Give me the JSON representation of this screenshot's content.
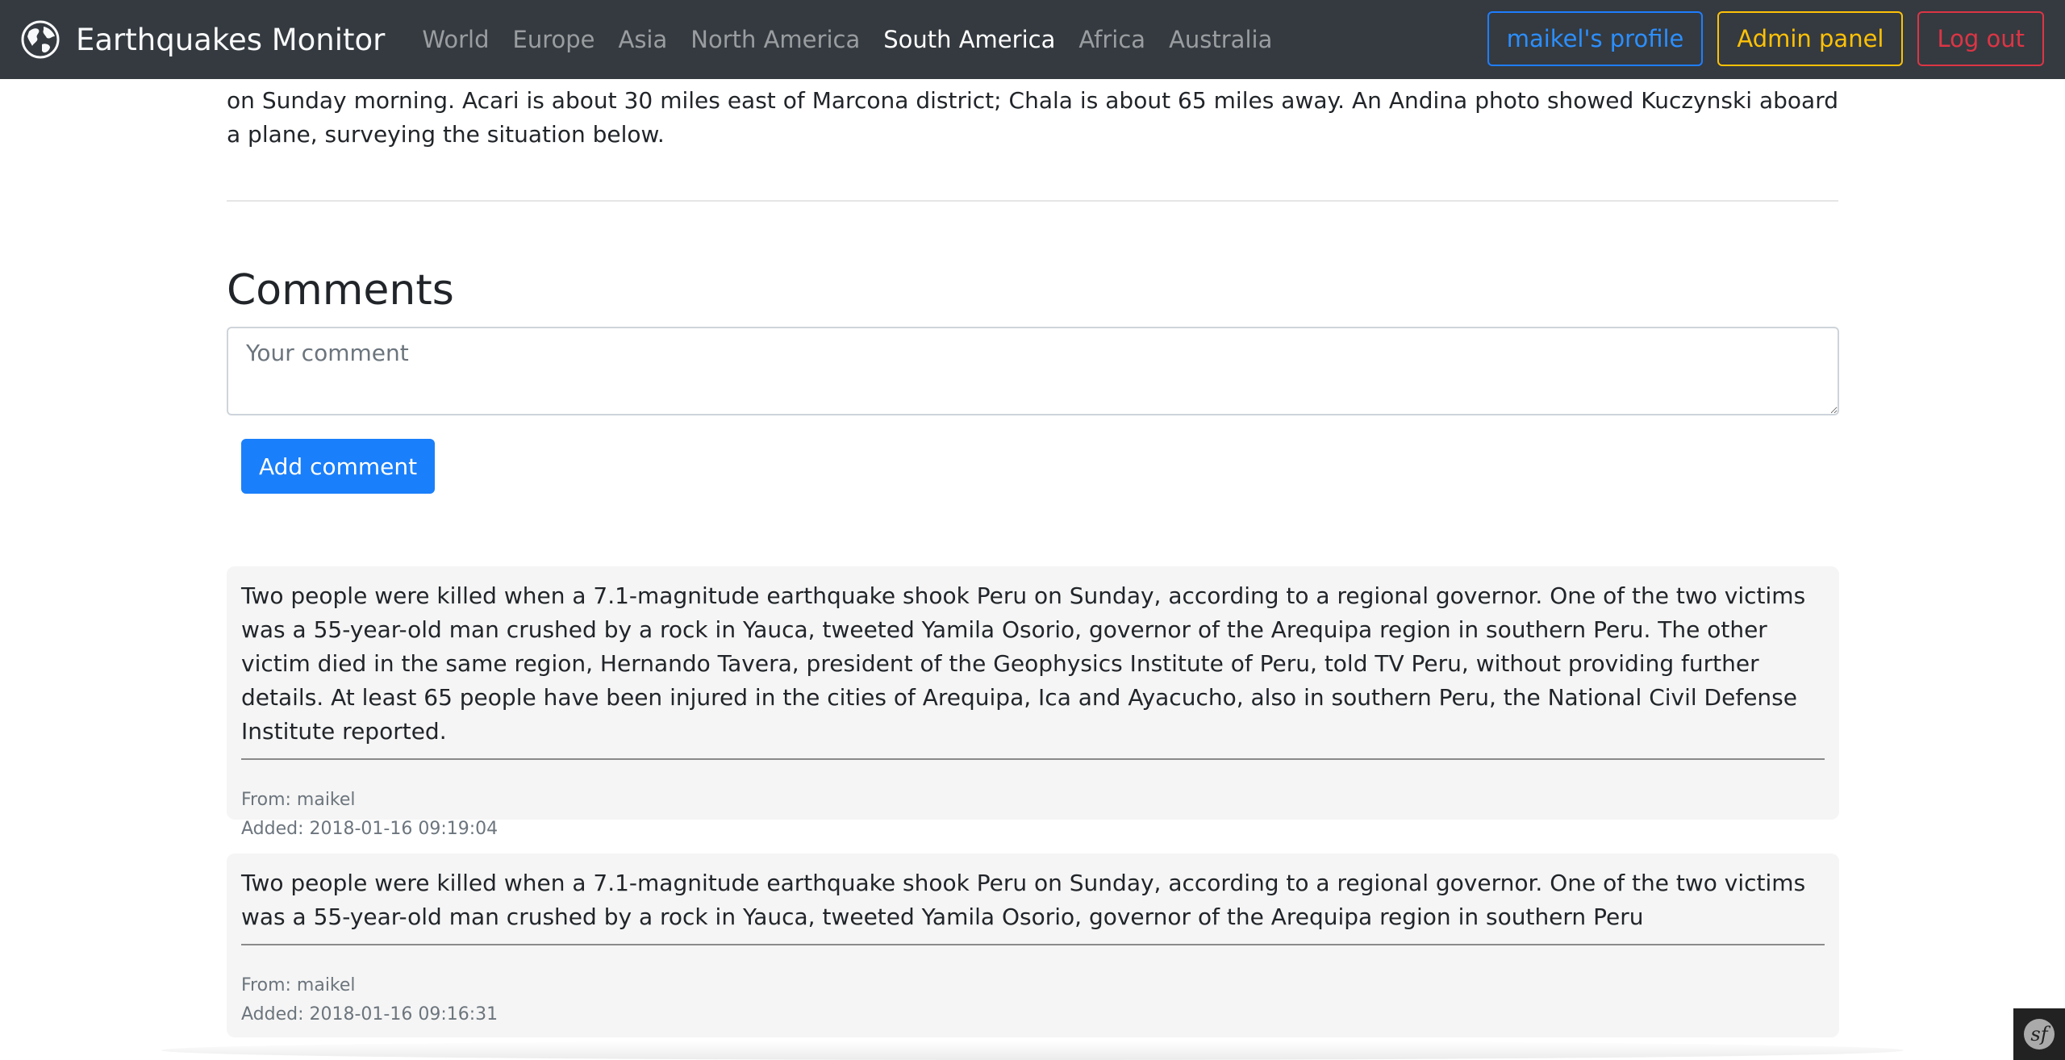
{
  "article": {
    "lines_text": "USGS said. Though it damaged roads in the region, ports and airports continue to operate normally, reported Andina, the state-run news agency. \"At this moment, we are heading from Marcona to Acari and Chala (Arequipa), zones affected by the earthquake overnight, to verify the magnitude of the damages and to send the corresponding humanitarian assistance,\" President Pedro Pablo Kuczynski tweeted in Spanish on Sunday morning. Acari is about 30 miles east of Marcona district; Chala is about 65 miles away. An Andina photo showed Kuczynski aboard a plane, surveying the situation below."
  },
  "navbar": {
    "brand": "Earthquakes Monitor",
    "links": [
      "World",
      "Europe",
      "Asia",
      "North America",
      "South America",
      "Africa",
      "Australia"
    ],
    "active_link": "South America",
    "profile_button": "maikel's profile",
    "admin_button": "Admin panel",
    "logout_button": "Log out"
  },
  "comments": {
    "title": "Comments",
    "input_placeholder": "Your comment",
    "add_button": "Add comment",
    "items": [
      {
        "text": "Two people were killed when a 7.1-magnitude earthquake shook Peru on Sunday, according to a regional governor. One of the two victims was a 55-year-old man crushed by a rock in Yauca, tweeted Yamila Osorio, governor of the Arequipa region in southern Peru. The other victim died in the same region, Hernando Tavera, president of the Geophysics Institute of Peru, told TV Peru, without providing further details. At least 65 people have been injured in the cities of Arequipa, Ica and Ayacucho, also in southern Peru, the National Civil Defense Institute reported.",
        "from": "From: maikel",
        "added": "Added: 2018-01-16 09:19:04"
      },
      {
        "text": "Two people were killed when a 7.1-magnitude earthquake shook Peru on Sunday, according to a regional governor. One of the two victims was a 55-year-old man crushed by a rock in Yauca, tweeted Yamila Osorio, governor of the Arequipa region in southern Peru",
        "from": "From: maikel",
        "added": "Added: 2018-01-16 09:16:31"
      }
    ]
  },
  "icons": {
    "brand": "globe-icon",
    "toolbar": "symfony-toolbar-icon"
  },
  "colors": {
    "navbar_bg": "#343a40",
    "primary": "#1a7ffa",
    "warning": "#ffc107",
    "danger": "#dc3545",
    "comment_bg": "#f5f5f5"
  }
}
